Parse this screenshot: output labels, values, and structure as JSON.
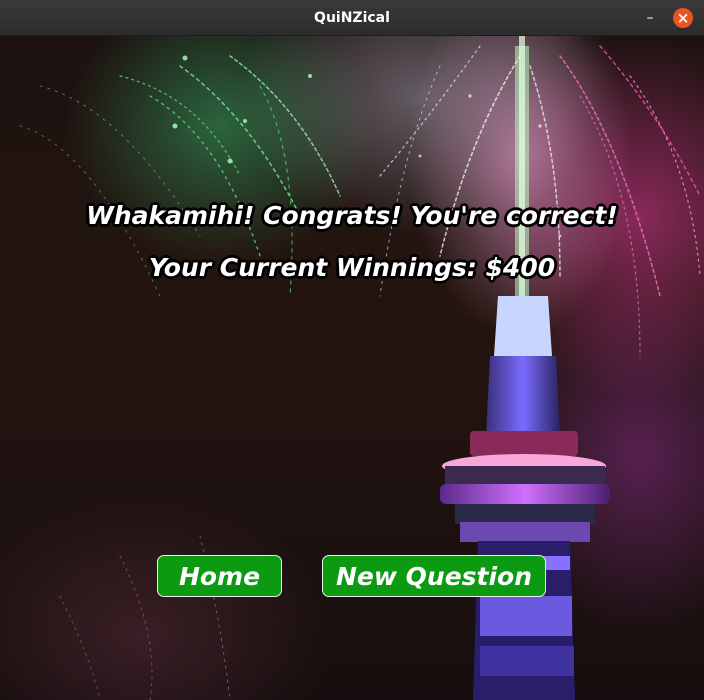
{
  "window": {
    "title": "QuiNZical",
    "minimize_symbol": "–",
    "close_symbol": "×"
  },
  "icons": {
    "minimize": "minimize-icon",
    "close": "close-icon"
  },
  "colors": {
    "button_green": "#0c9a12",
    "close_orange": "#e95420",
    "text_white": "#ffffff"
  },
  "result": {
    "message": "Whakamihi! Congrats! You're correct!",
    "winnings": "Your Current Winnings: $400"
  },
  "buttons": {
    "home_label": "Home",
    "new_question_label": "New Question"
  }
}
